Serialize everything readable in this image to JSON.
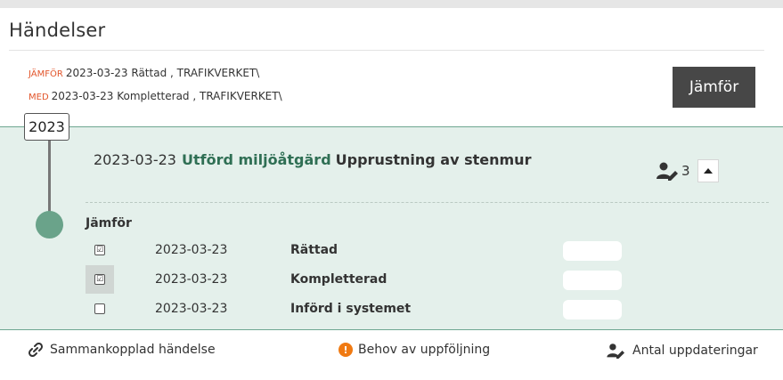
{
  "panel": {
    "title": "Händelser"
  },
  "compare": {
    "line1_tag": "JÄMFÖR",
    "line1_text": "2023-03-23 Rättad , TRAFIKVERKET\\",
    "line2_tag": "MED",
    "line2_text": "2023-03-23 Kompletterad , TRAFIKVERKET\\",
    "button_label": "Jämför"
  },
  "timeline": {
    "year": "2023"
  },
  "event": {
    "date": "2023-03-23",
    "type": "Utförd miljöåtgärd",
    "description": "Upprustning av stenmur",
    "update_count": "3",
    "compare_title": "Jämför",
    "versions": [
      {
        "date": "2023-03-23",
        "status": "Rättad",
        "checked": true,
        "check_mark": "☑"
      },
      {
        "date": "2023-03-23",
        "status": "Kompletterad",
        "checked": true,
        "check_mark": "☑"
      },
      {
        "date": "2023-03-23",
        "status": "Införd i systemet",
        "checked": false,
        "check_mark": ""
      }
    ]
  },
  "legend": {
    "linked_label": "Sammankopplad händelse",
    "followup_label": "Behov av uppföljning",
    "followup_glyph": "!",
    "updates_label": "Antal uppdateringar"
  },
  "colors": {
    "accent_green": "#6aa38a",
    "event_type_green": "#2f6f54",
    "section_bg": "#e4f0eb",
    "compare_tag": "#e2552b",
    "followup_orange": "#f07a12",
    "button_dark": "#474747"
  },
  "icons": {
    "user_edit": "user-edit-icon",
    "collapse": "chevron-up-icon",
    "link": "link-icon",
    "followup": "exclamation-circle-icon"
  }
}
